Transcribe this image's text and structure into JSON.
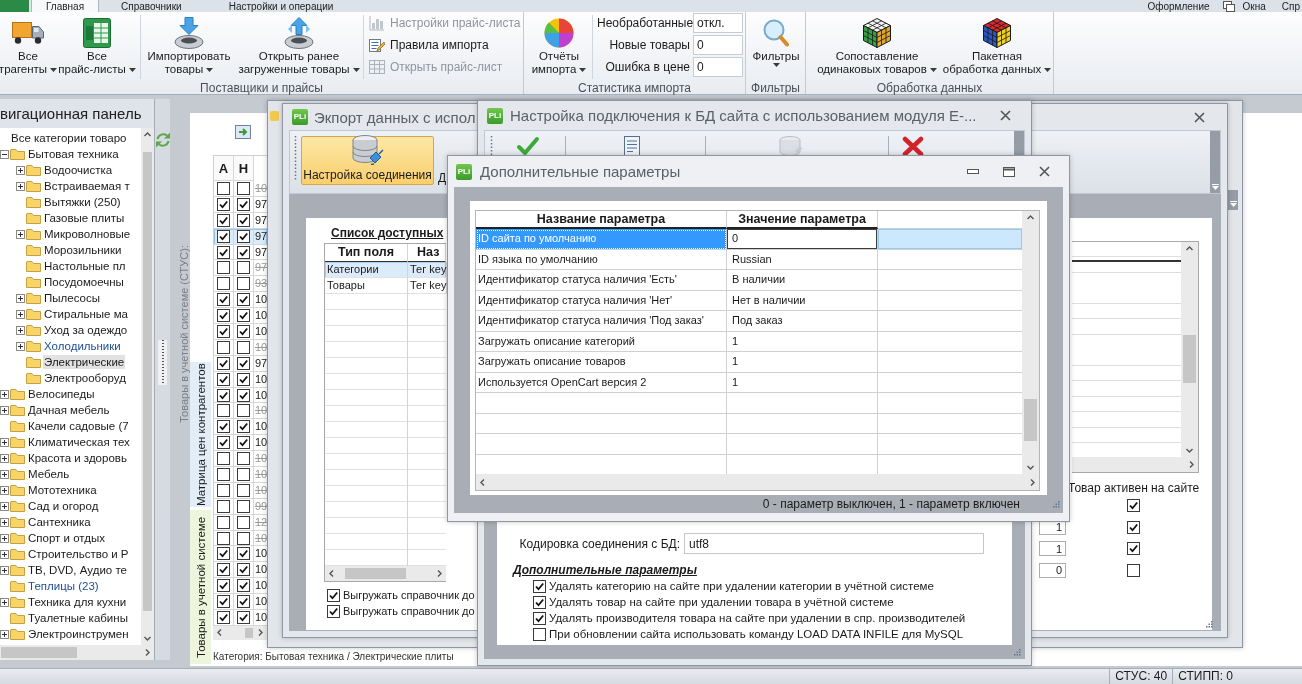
{
  "ribbon": {
    "tabs": [
      {
        "label": "Главная",
        "selected": true
      },
      {
        "label": "Справочники",
        "selected": false
      },
      {
        "label": "Настройки и операции",
        "selected": false
      }
    ],
    "quick_links": [
      {
        "label": "Оформление"
      },
      {
        "label": "Окна"
      },
      {
        "label": "Спр"
      }
    ],
    "groups": [
      {
        "label": "Поставщики и прайсы",
        "large_buttons": [
          {
            "lines": [
              "Все",
              "трагенты"
            ],
            "dropdown": true
          },
          {
            "lines": [
              "Все",
              "прайс-листы"
            ],
            "dropdown": true
          },
          {
            "lines": [
              "Импортировать",
              "товары"
            ],
            "dropdown": true
          },
          {
            "lines": [
              "Открыть ранее",
              "загруженные товары"
            ],
            "dropdown": true
          }
        ],
        "small_buttons": [
          {
            "label": "Настройки прайс-листа",
            "disabled": true
          },
          {
            "label": "Правила импорта",
            "disabled": false
          },
          {
            "label": "Открыть прайс-лист",
            "disabled": true
          }
        ]
      },
      {
        "label": "Статистика импорта",
        "large_buttons": [
          {
            "lines": [
              "Отчёты",
              "импорта"
            ],
            "dropdown": true
          }
        ],
        "counters": [
          {
            "label": "Необработанные",
            "value": "откл."
          },
          {
            "label": "Новые товары",
            "value": "0"
          },
          {
            "label": "Ошибка в цене",
            "value": "0"
          }
        ]
      },
      {
        "label": "Фильтры",
        "large_buttons": [
          {
            "lines": [
              "Фильтры"
            ],
            "dropdown": true
          }
        ]
      },
      {
        "label": "Обработка данных",
        "large_buttons": [
          {
            "lines": [
              "Сопоставление",
              "одинаковых товаров"
            ],
            "dropdown": true
          },
          {
            "lines": [
              "Пакетная",
              "обработка данных"
            ],
            "dropdown": true
          }
        ]
      }
    ]
  },
  "navigation": {
    "title": "вигационная панель",
    "tree": [
      {
        "label": "Все категории товаро",
        "kind": "root",
        "selected": false,
        "highlighted": false,
        "children": [
          {
            "label": "Бытовая техника",
            "kind": "branch",
            "expanded": true,
            "selected": false,
            "highlighted": false,
            "children": [
              {
                "label": "Водоочистка",
                "kind": "branch",
                "expanded": false,
                "selected": false,
                "highlighted": false
              },
              {
                "label": "Встраиваемая т",
                "kind": "branch",
                "expanded": false,
                "selected": false,
                "highlighted": false
              },
              {
                "label": "Вытяжки (250)",
                "kind": "leaf",
                "selected": false,
                "highlighted": false
              },
              {
                "label": "Газовые плиты",
                "kind": "leaf",
                "selected": false,
                "highlighted": false
              },
              {
                "label": "Микроволновые",
                "kind": "branch",
                "expanded": false,
                "selected": false,
                "highlighted": false
              },
              {
                "label": "Морозильники",
                "kind": "leaf",
                "selected": false,
                "highlighted": false
              },
              {
                "label": "Настольные пл",
                "kind": "leaf",
                "selected": false,
                "highlighted": false
              },
              {
                "label": "Посудомоечны",
                "kind": "leaf",
                "selected": false,
                "highlighted": false
              },
              {
                "label": "Пылесосы",
                "kind": "branch",
                "expanded": false,
                "selected": false,
                "highlighted": false
              },
              {
                "label": "Стиральные ма",
                "kind": "branch",
                "expanded": false,
                "selected": false,
                "highlighted": false
              },
              {
                "label": "Уход за одеждо",
                "kind": "branch",
                "expanded": false,
                "selected": false,
                "highlighted": false
              },
              {
                "label": "Холодильники",
                "kind": "branch",
                "expanded": false,
                "selected": false,
                "highlighted": true
              },
              {
                "label": "Электрические",
                "kind": "leaf",
                "selected": true,
                "highlighted": false
              },
              {
                "label": "Электрооборуд",
                "kind": "leaf",
                "selected": false,
                "highlighted": false
              }
            ]
          },
          {
            "label": "Велосипеды",
            "kind": "branch",
            "expanded": false,
            "selected": false,
            "highlighted": false
          },
          {
            "label": "Дачная мебель",
            "kind": "branch",
            "expanded": false,
            "selected": false,
            "highlighted": false
          },
          {
            "label": "Качели садовые (7",
            "kind": "leaf",
            "selected": false,
            "highlighted": false
          },
          {
            "label": "Климатическая тех",
            "kind": "branch",
            "expanded": false,
            "selected": false,
            "highlighted": false
          },
          {
            "label": "Красота и здоровь",
            "kind": "branch",
            "expanded": false,
            "selected": false,
            "highlighted": false
          },
          {
            "label": "Мебель",
            "kind": "branch",
            "expanded": false,
            "selected": false,
            "highlighted": false
          },
          {
            "label": "Мототехника",
            "kind": "branch",
            "expanded": false,
            "selected": false,
            "highlighted": false
          },
          {
            "label": "Сад и огород",
            "kind": "branch",
            "expanded": false,
            "selected": false,
            "highlighted": false
          },
          {
            "label": "Сантехника",
            "kind": "branch",
            "expanded": false,
            "selected": false,
            "highlighted": false
          },
          {
            "label": "Спорт и отдых",
            "kind": "branch",
            "expanded": false,
            "selected": false,
            "highlighted": false
          },
          {
            "label": "Строительство и Р",
            "kind": "branch",
            "expanded": false,
            "selected": false,
            "highlighted": false
          },
          {
            "label": "ТВ, DVD, Аудио те",
            "kind": "branch",
            "expanded": false,
            "selected": false,
            "highlighted": false
          },
          {
            "label": "Теплицы (23)",
            "kind": "leaf",
            "selected": false,
            "highlighted": true
          },
          {
            "label": "Техника для кухни",
            "kind": "branch",
            "expanded": false,
            "selected": false,
            "highlighted": false
          },
          {
            "label": "Туалетные кабины",
            "kind": "leaf",
            "selected": false,
            "highlighted": false
          },
          {
            "label": "Электроинструмен",
            "kind": "branch",
            "expanded": false,
            "selected": false,
            "highlighted": false
          }
        ]
      }
    ]
  },
  "products": {
    "caption": "Товары в учетной системе (СТУС):",
    "side_tabs": [
      {
        "label": "Матрица цен контрагентов",
        "selected": false
      },
      {
        "label": "Товары в учетной системе",
        "selected": true
      }
    ],
    "columns": [
      "А",
      "Н"
    ],
    "rows": [
      {
        "checks": [
          false,
          false
        ],
        "code": "10",
        "selected": false
      },
      {
        "checks": [
          true,
          true
        ],
        "code": "97",
        "selected": false
      },
      {
        "checks": [
          true,
          true
        ],
        "code": "97",
        "selected": false
      },
      {
        "checks": [
          true,
          true
        ],
        "code": "97",
        "selected": true
      },
      {
        "checks": [
          true,
          true
        ],
        "code": "97",
        "selected": false
      },
      {
        "checks": [
          false,
          false
        ],
        "code": "97",
        "selected": false
      },
      {
        "checks": [
          false,
          false
        ],
        "code": "93",
        "selected": false
      },
      {
        "checks": [
          true,
          true
        ],
        "code": "10",
        "selected": false
      },
      {
        "checks": [
          true,
          true
        ],
        "code": "10",
        "selected": false
      },
      {
        "checks": [
          true,
          true
        ],
        "code": "10",
        "selected": false
      },
      {
        "checks": [
          false,
          false
        ],
        "code": "10",
        "selected": false
      },
      {
        "checks": [
          true,
          true
        ],
        "code": "97",
        "selected": false
      },
      {
        "checks": [
          true,
          true
        ],
        "code": "10",
        "selected": false
      },
      {
        "checks": [
          true,
          true
        ],
        "code": "10",
        "selected": false
      },
      {
        "checks": [
          false,
          false
        ],
        "code": "10",
        "selected": false
      },
      {
        "checks": [
          true,
          true
        ],
        "code": "10",
        "selected": false
      },
      {
        "checks": [
          true,
          true
        ],
        "code": "10",
        "selected": false
      },
      {
        "checks": [
          false,
          false
        ],
        "code": "10",
        "selected": false
      },
      {
        "checks": [
          false,
          false
        ],
        "code": "10",
        "selected": false
      },
      {
        "checks": [
          false,
          false
        ],
        "code": "10",
        "selected": false
      },
      {
        "checks": [
          false,
          false
        ],
        "code": "99",
        "selected": false
      },
      {
        "checks": [
          false,
          false
        ],
        "code": "12",
        "selected": false
      },
      {
        "checks": [
          false,
          false
        ],
        "code": "10",
        "selected": false
      },
      {
        "checks": [
          true,
          true
        ],
        "code": "10",
        "selected": false
      },
      {
        "checks": [
          true,
          true
        ],
        "code": "10",
        "selected": false
      },
      {
        "checks": [
          true,
          true
        ],
        "code": "10",
        "selected": false
      },
      {
        "checks": [
          true,
          true
        ],
        "code": "10",
        "selected": false
      },
      {
        "checks": [
          true,
          true
        ],
        "code": "10",
        "selected": false
      }
    ],
    "path": "Категория: Бытовая техника / Электрические плиты"
  },
  "export_window": {
    "logo": "PLi",
    "title": "Экпорт данных с испол",
    "toolbar": [
      {
        "label": "Настройка соединения",
        "selected": true
      },
      {
        "label": "Д",
        "selected": false
      }
    ],
    "list_title": "Список доступных",
    "list_columns": [
      "Тип поля",
      "Наз"
    ],
    "list_rows": [
      {
        "cells": [
          "Категории",
          "Тег key"
        ],
        "selected": true
      },
      {
        "cells": [
          "Товары",
          "Тег key"
        ],
        "selected": false
      }
    ],
    "options": [
      {
        "label": "Выгружать справочник до",
        "checked": true
      },
      {
        "label": "Выгружать справочник до",
        "checked": true
      }
    ],
    "activity_column": "Товар активен на сайте",
    "activity_rows": [
      {
        "checked": true
      },
      {
        "value": "1",
        "checked": true
      },
      {
        "value": "1",
        "checked": true
      },
      {
        "value": "0",
        "checked": false
      }
    ]
  },
  "connection_window": {
    "logo": "PLi",
    "title": "Настройка подключения к БД сайта с использованием модуля E-...",
    "encoding": {
      "label": "Кодировка соединения с БД:",
      "value": "utf8"
    },
    "section_title": "Дополнительные параметры",
    "options": [
      {
        "label": "Удалять категорию на сайте при удалении категории в учётной системе",
        "checked": true
      },
      {
        "label": "Удалять товар на сайте при удалении товара в учётной системе",
        "checked": true
      },
      {
        "label": "Удалять производителя товара на сайте при удалении в спр. производителей",
        "checked": true
      },
      {
        "label": "При обновлении сайта использовать команду LOAD DATA INFILE для MySQL",
        "checked": false
      }
    ]
  },
  "parameters_dialog": {
    "logo": "PLi",
    "title": "Дополнительные параметры",
    "columns": [
      "Название параметра",
      "Значение параметра"
    ],
    "rows": [
      {
        "name": "ID сайта по умолчанию",
        "value": "0",
        "selected": true
      },
      {
        "name": "ID языка по умолчанию",
        "value": "Russian",
        "selected": false
      },
      {
        "name": "Идентификатор статуса наличия 'Есть'",
        "value": "В наличии",
        "selected": false
      },
      {
        "name": "Идентификатор статуса наличия 'Нет'",
        "value": "Нет в наличии",
        "selected": false
      },
      {
        "name": "Идентификатор статуса наличия 'Под заказ'",
        "value": "Под заказ",
        "selected": false
      },
      {
        "name": "Загружать описание категорий",
        "value": "1",
        "selected": false
      },
      {
        "name": "Загружать описание товаров",
        "value": "1",
        "selected": false
      },
      {
        "name": "Используется OpenCart версия 2",
        "value": "1",
        "selected": false
      }
    ],
    "footer": "0 - параметр выключен, 1 - параметр включен"
  },
  "status_bar": {
    "items": [
      "СТУС: 40",
      "СТИПП: 0"
    ]
  }
}
